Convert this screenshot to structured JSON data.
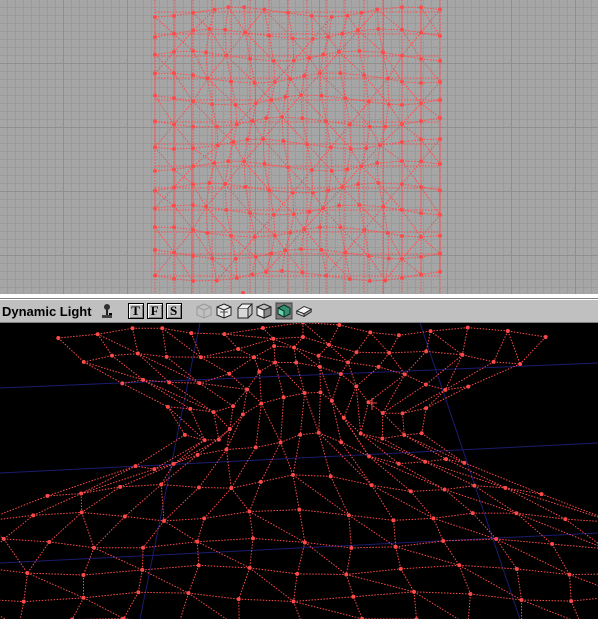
{
  "toolbar": {
    "mode_label": "Dynamic Light",
    "view_buttons": [
      {
        "label": "T",
        "name": "top-view-button"
      },
      {
        "label": "F",
        "name": "front-view-button"
      },
      {
        "label": "S",
        "name": "side-view-button"
      }
    ],
    "render_mode_icons": [
      "wireframe-cube-icon",
      "zone-cube-icon",
      "texture-usage-cube-icon",
      "bsp-cube-icon",
      "dynamic-light-cube-icon",
      "textured-cube-icon"
    ]
  },
  "colors": {
    "wire": "#ff4a4a",
    "grid_bg": "#a6a6a6",
    "persp_bg": "#000000",
    "bsp_lines": "#1c1c6e"
  }
}
